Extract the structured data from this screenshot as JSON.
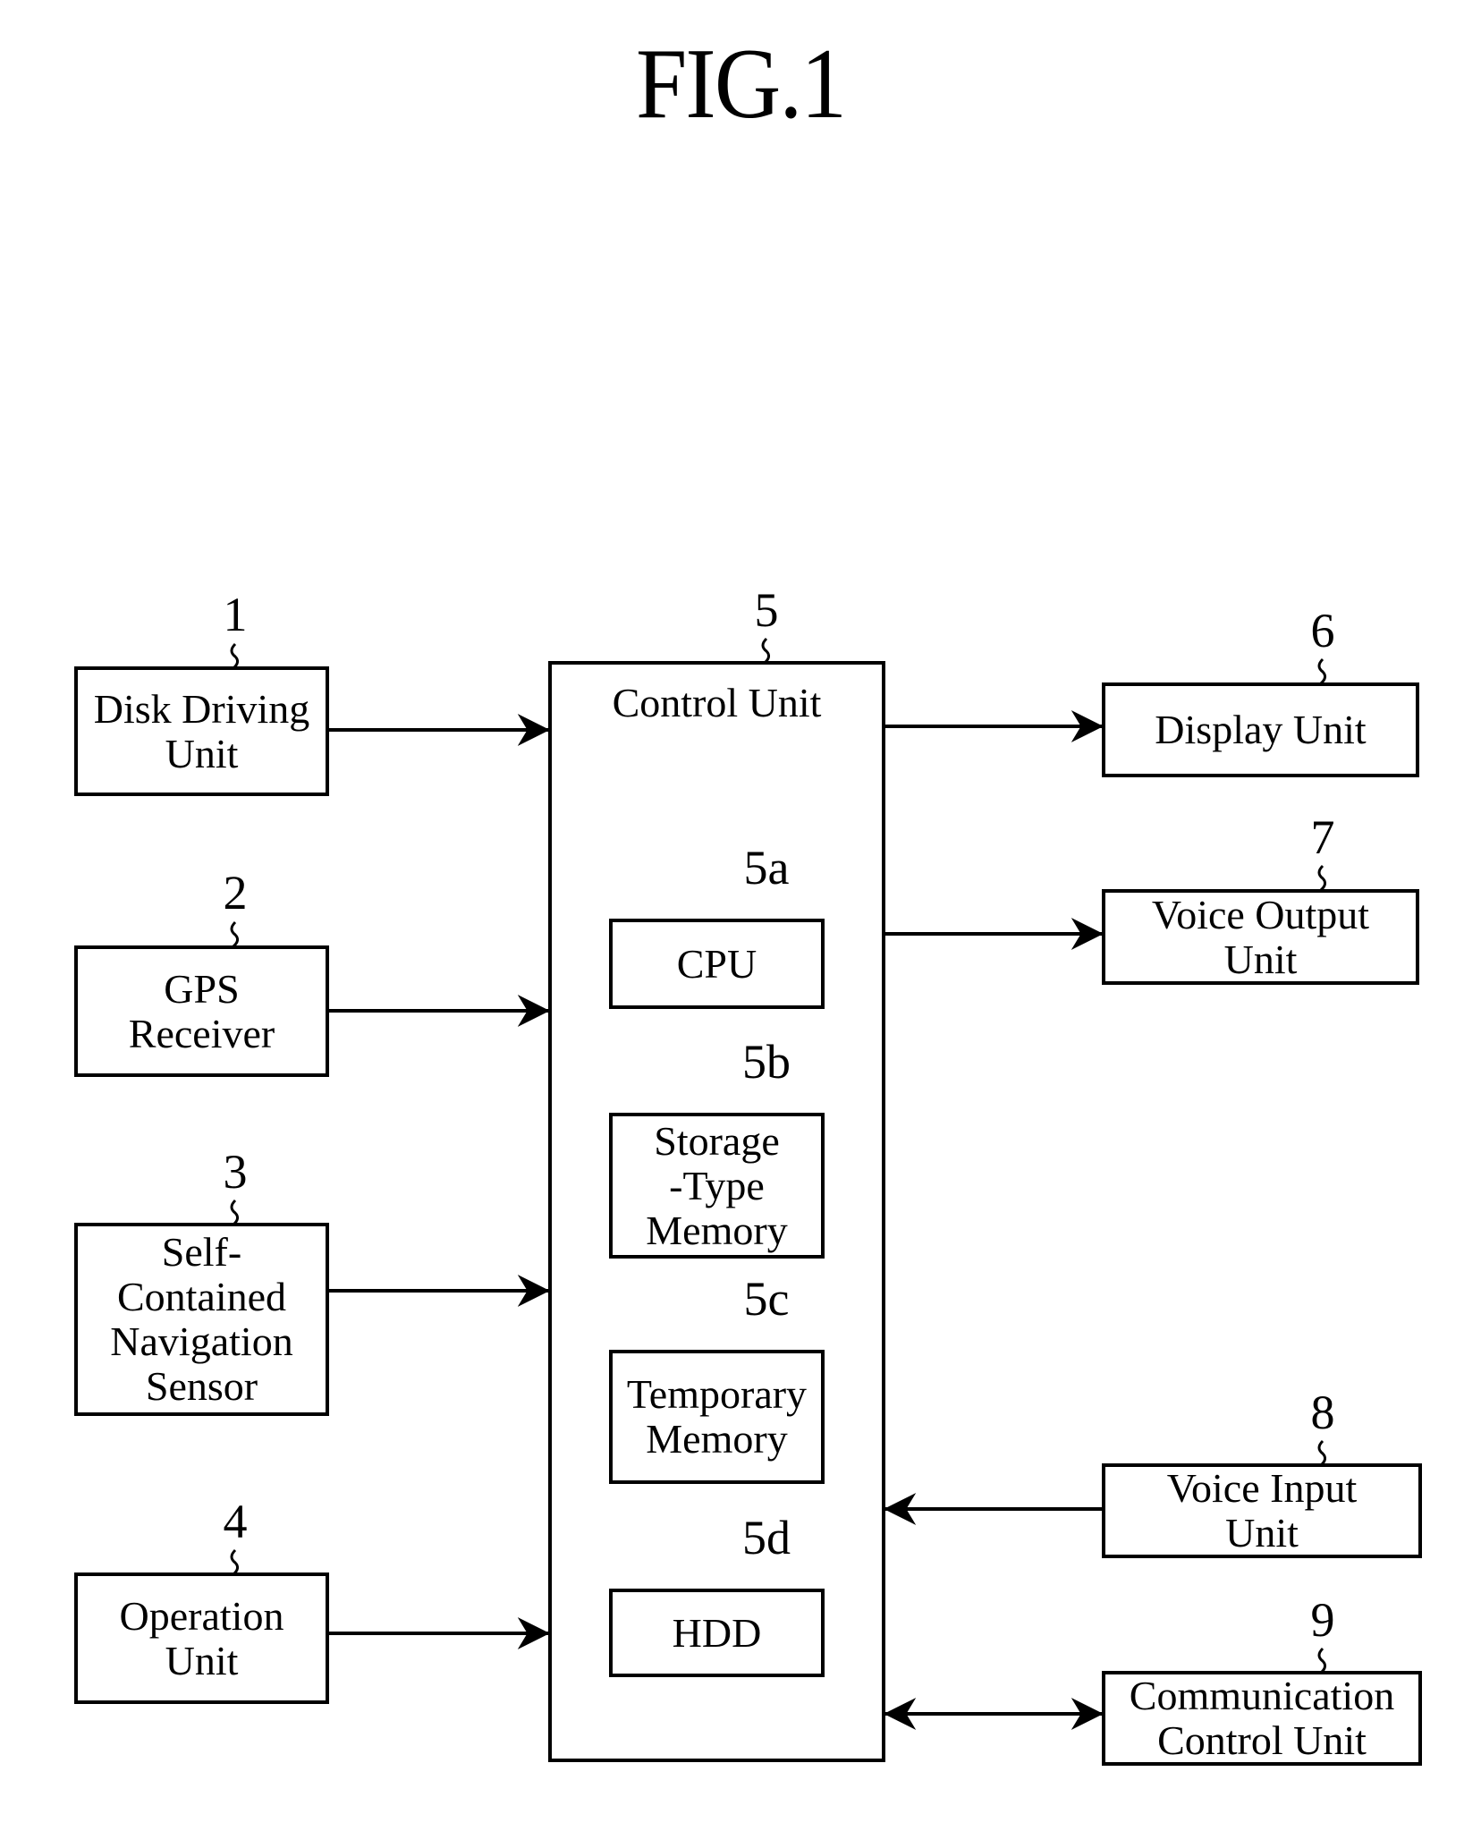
{
  "figure": {
    "title": "FIG.1"
  },
  "blocks": {
    "disk_driving_unit": {
      "ref": "1",
      "label": "Disk Driving\nUnit"
    },
    "gps_receiver": {
      "ref": "2",
      "label": "GPS\nReceiver"
    },
    "navigation_sensor": {
      "ref": "3",
      "label": "Self-\nContained\nNavigation\nSensor"
    },
    "operation_unit": {
      "ref": "4",
      "label": "Operation\nUnit"
    },
    "control_unit": {
      "ref": "5",
      "label": "Control Unit"
    },
    "cpu": {
      "ref": "5a",
      "label": "CPU"
    },
    "storage_memory": {
      "ref": "5b",
      "label": "Storage\n-Type\nMemory"
    },
    "temporary_memory": {
      "ref": "5c",
      "label": "Temporary\nMemory"
    },
    "hdd": {
      "ref": "5d",
      "label": "HDD"
    },
    "display_unit": {
      "ref": "6",
      "label": "Display Unit"
    },
    "voice_output_unit": {
      "ref": "7",
      "label": "Voice Output\nUnit"
    },
    "voice_input_unit": {
      "ref": "8",
      "label": "Voice Input\nUnit"
    },
    "communication_control_unit": {
      "ref": "9",
      "label": "Communication\nControl Unit"
    }
  },
  "connections": [
    {
      "from": "Disk Driving Unit",
      "to": "Control Unit",
      "direction": "one-way"
    },
    {
      "from": "GPS Receiver",
      "to": "Control Unit",
      "direction": "one-way"
    },
    {
      "from": "Self-Contained Navigation Sensor",
      "to": "Control Unit",
      "direction": "one-way"
    },
    {
      "from": "Operation Unit",
      "to": "Control Unit",
      "direction": "one-way"
    },
    {
      "from": "Control Unit",
      "to": "Display Unit",
      "direction": "one-way"
    },
    {
      "from": "Control Unit",
      "to": "Voice Output Unit",
      "direction": "one-way"
    },
    {
      "from": "Voice Input Unit",
      "to": "Control Unit",
      "direction": "one-way"
    },
    {
      "from": "Control Unit",
      "to": "Communication Control Unit",
      "direction": "two-way"
    }
  ]
}
